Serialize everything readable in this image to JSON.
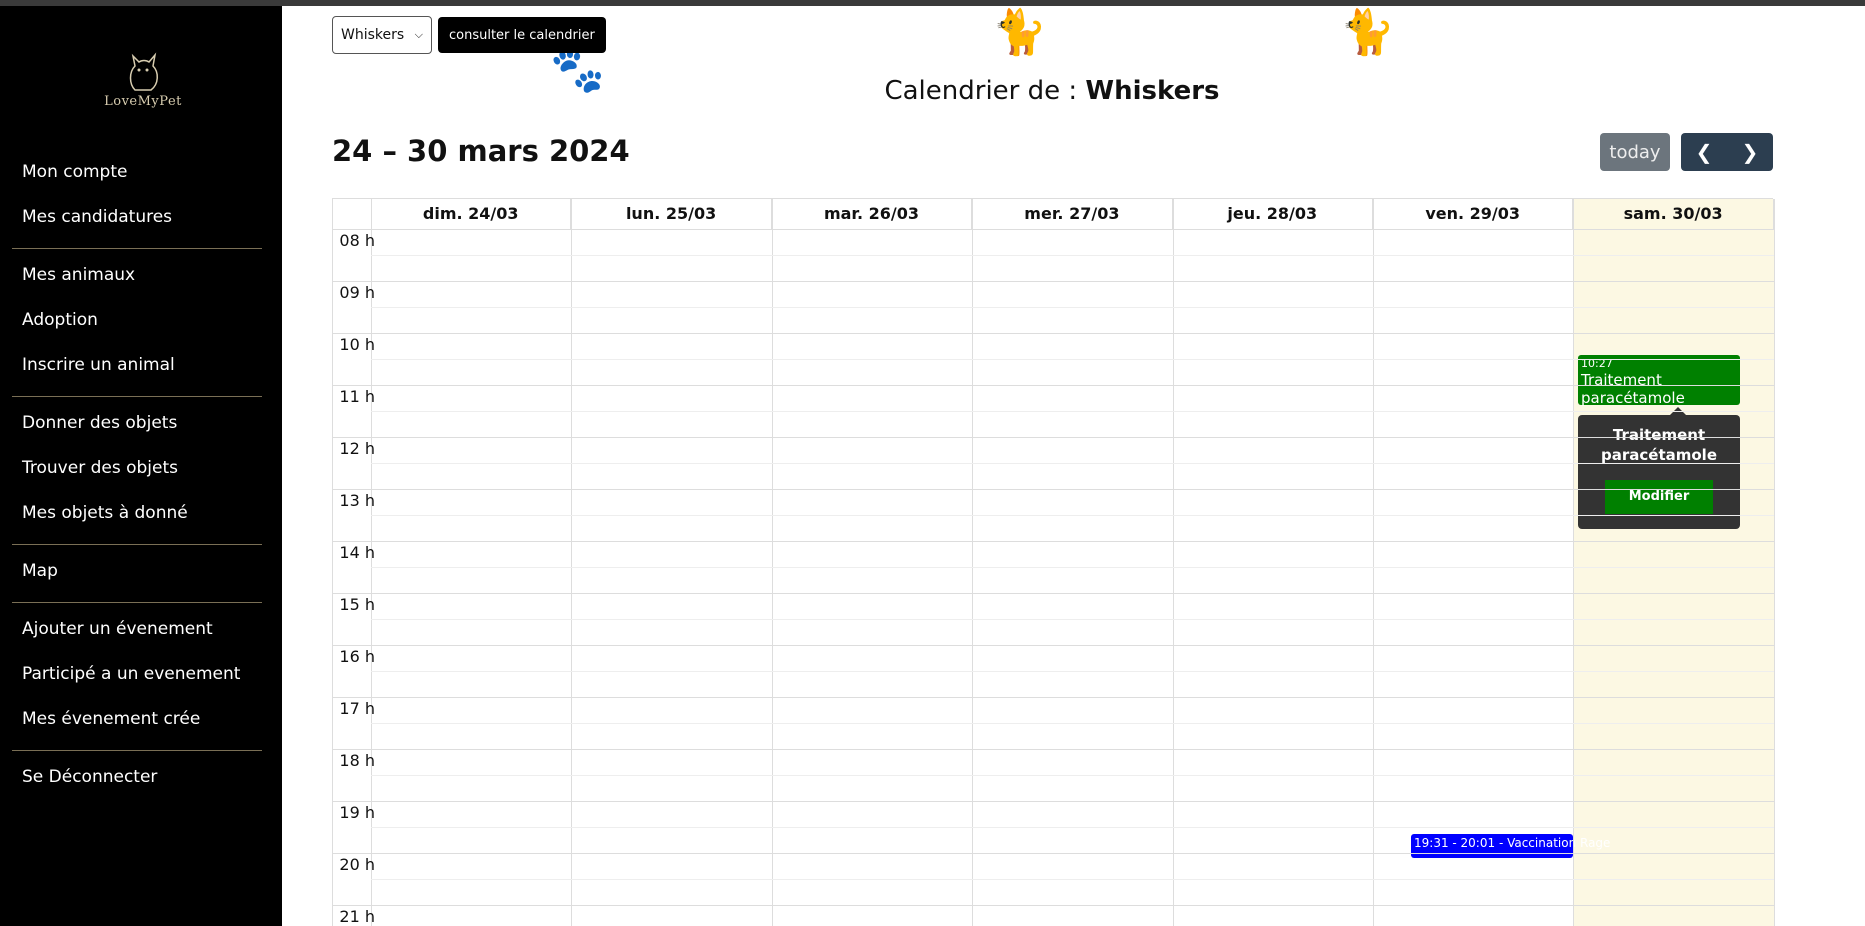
{
  "sidebar": {
    "logo_text": "LoveMyPet",
    "groups": [
      [
        "Mon compte",
        "Mes candidatures"
      ],
      [
        "Mes animaux",
        "Adoption",
        "Inscrire un animal"
      ],
      [
        "Donner des objets",
        "Trouver des objets",
        "Mes objets à donné"
      ],
      [
        "Map"
      ],
      [
        "Ajouter un évenement",
        "Participé a un evenement",
        "Mes évenement crée"
      ],
      [
        "Se Déconnecter"
      ]
    ]
  },
  "picker": {
    "selected": "Whiskers",
    "button": "consulter le calendrier"
  },
  "title": {
    "prefix": "Calendrier de : ",
    "name": "Whiskers"
  },
  "toolbar": {
    "range": "24 – 30 mars 2024",
    "today": "today"
  },
  "days": [
    "dim. 24/03",
    "lun. 25/03",
    "mar. 26/03",
    "mer. 27/03",
    "jeu. 28/03",
    "ven. 29/03",
    "sam. 30/03"
  ],
  "hours": [
    "08 h",
    "09 h",
    "10 h",
    "11 h",
    "12 h",
    "13 h",
    "14 h",
    "15 h",
    "16 h",
    "17 h",
    "18 h",
    "19 h",
    "20 h",
    "21 h"
  ],
  "events": {
    "green": {
      "time": "10:27",
      "name": "Traitement paracétamole",
      "day": "sam. 30/03",
      "color": "#008000"
    },
    "blue": {
      "label": "19:31 - 20:01 - Vaccination Rage",
      "day": "ven. 29/03",
      "color": "#0000ff"
    }
  },
  "popover": {
    "title": "Traitement paracétamole",
    "button": "Modifier"
  }
}
